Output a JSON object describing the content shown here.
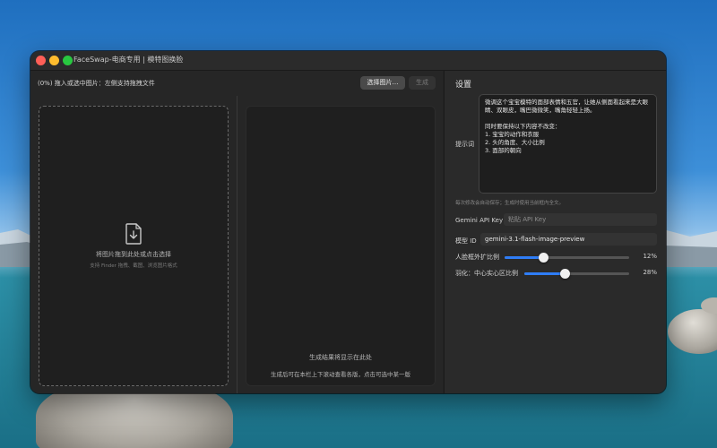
{
  "window": {
    "title": "FaceSwap-电商专用 | 模特图换脸"
  },
  "left_panel": {
    "status_text": "(0%) 拖入或选中图片：左侧支持拖拽文件",
    "select_button_label": "选择图片…",
    "generate_button_label": "生成",
    "dropzone": {
      "title": "将图片拖到此处或点击选择",
      "subtitle": "支持 Finder 拖拽、截图、浏览图片格式",
      "icon": "document-download-icon"
    },
    "result": {
      "title": "生成结果将显示在此处",
      "subtitle": "生成后可在本栏上下滚动查看各版，点击可选中某一版"
    }
  },
  "settings": {
    "title": "设置",
    "prompt_label": "提示词",
    "prompt_text": "微调这个宝宝模特的面部表情和五官，让她从侧面看起来是大眼睛、双眼皮，嘴巴微微笑，嘴角轻轻上扬。\n\n同时要保持以下内容不改变：\n1. 宝宝的动作和衣服\n2. 头的角度、大小比例\n3. 面部的朝向",
    "autosave_note": "每次修改会自动保存；生成时使用当前框内全文。",
    "api_key_label": "Gemini API Key",
    "api_key_placeholder": "粘贴 API Key",
    "model_label": "模型 ID",
    "model_value": "gemini-3.1-flash-image-preview",
    "sliders": [
      {
        "label": "人脸框外扩比例",
        "value_text": "12%",
        "fraction": 0.31
      },
      {
        "label": "羽化：中心实心区比例",
        "value_text": "28%",
        "fraction": 0.39
      }
    ]
  },
  "colors": {
    "accent": "#2f7df6",
    "close": "#ff5f57",
    "minimize": "#febc2e",
    "zoom": "#28c840"
  }
}
